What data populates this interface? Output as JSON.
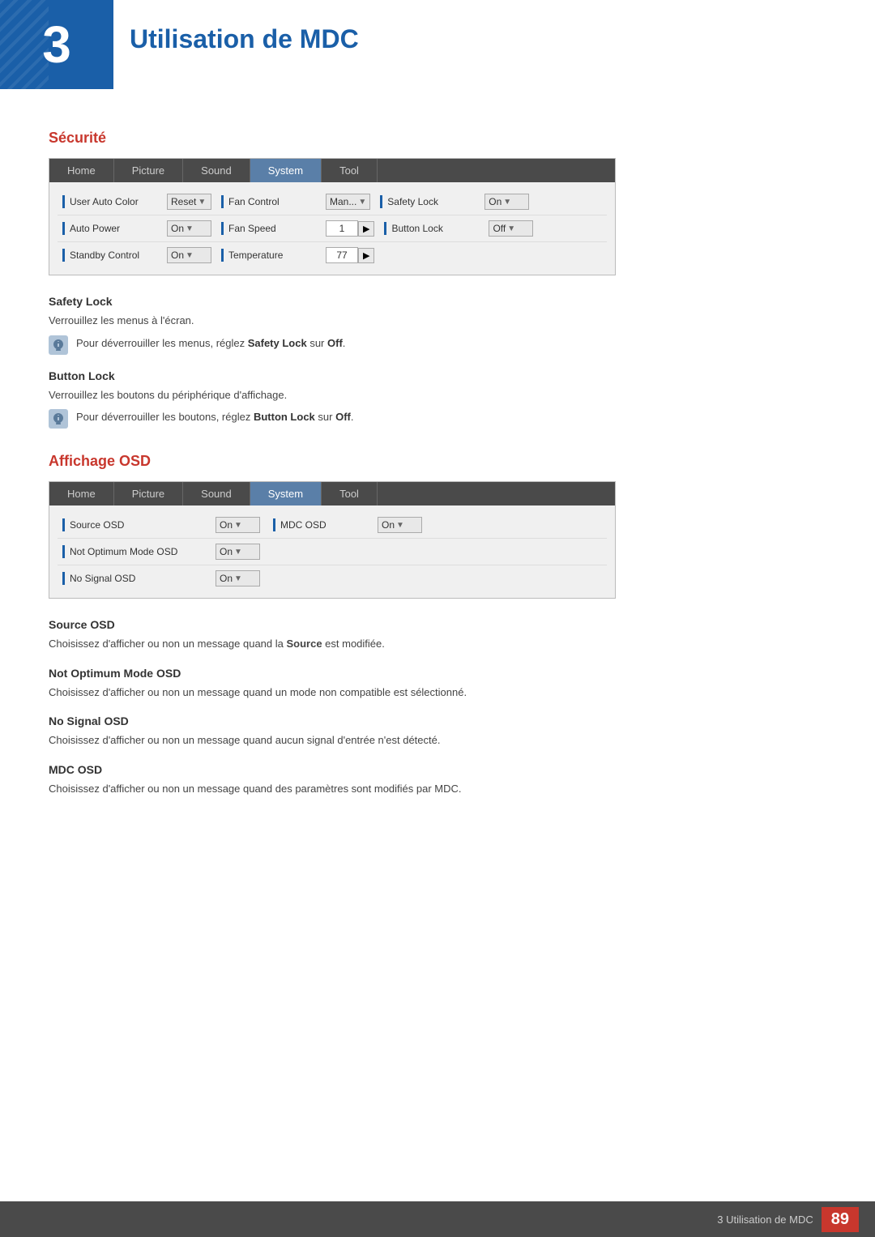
{
  "header": {
    "number": "3",
    "title": "Utilisation de MDC"
  },
  "sections": {
    "securite": {
      "title": "Sécurité",
      "panel1": {
        "tabs": [
          "Home",
          "Picture",
          "Sound",
          "System",
          "Tool"
        ],
        "active_tab": "System",
        "rows": [
          {
            "col1_label": "User Auto Color",
            "col1_control": "Reset ▼",
            "col2_label": "Fan Control",
            "col2_control": "Man... ▼",
            "col3_label": "Safety Lock",
            "col3_control": "On ▼"
          },
          {
            "col1_label": "Auto Power",
            "col1_control": "On ▼",
            "col2_label": "Fan Speed",
            "col2_control": "1 ▶",
            "col3_label": "Button Lock",
            "col3_control": "Off ▼"
          },
          {
            "col1_label": "Standby Control",
            "col1_control": "On ▼",
            "col2_label": "Temperature",
            "col2_control": "77 ▶",
            "col3_label": "",
            "col3_control": ""
          }
        ]
      },
      "safety_lock": {
        "heading": "Safety Lock",
        "body": "Verrouillez les menus à l'écran.",
        "note": "Pour déverrouiller les menus, réglez <b>Safety Lock</b> sur <b>Off</b>."
      },
      "button_lock": {
        "heading": "Button Lock",
        "body": "Verrouillez les boutons du périphérique d'affichage.",
        "note": "Pour déverrouiller les boutons, réglez <b>Button Lock</b> sur <b>Off</b>."
      }
    },
    "affichage_osd": {
      "title": "Affichage OSD",
      "panel2": {
        "tabs": [
          "Home",
          "Picture",
          "Sound",
          "System",
          "Tool"
        ],
        "active_tab": "System",
        "rows": [
          {
            "col1_label": "Source OSD",
            "col1_control": "On ▼",
            "col2_label": "MDC OSD",
            "col2_control": "On ▼"
          },
          {
            "col1_label": "Not Optimum Mode OSD",
            "col1_control": "On ▼",
            "col2_label": "",
            "col2_control": ""
          },
          {
            "col1_label": "No Signal OSD",
            "col1_control": "On ▼",
            "col2_label": "",
            "col2_control": ""
          }
        ]
      },
      "source_osd": {
        "heading": "Source OSD",
        "body": "Choisissez d'afficher ou non un message quand la <b>Source</b> est modifiée."
      },
      "not_optimum_osd": {
        "heading": "Not Optimum Mode OSD",
        "body": "Choisissez d'afficher ou non un message quand un mode non compatible est sélectionné."
      },
      "no_signal_osd": {
        "heading": "No Signal OSD",
        "body": "Choisissez d'afficher ou non un message quand aucun signal d'entrée n'est détecté."
      },
      "mdc_osd": {
        "heading": "MDC OSD",
        "body": "Choisissez d'afficher ou non un message quand des paramètres sont modifiés par MDC."
      }
    }
  },
  "footer": {
    "text": "3 Utilisation de MDC",
    "page": "89"
  }
}
